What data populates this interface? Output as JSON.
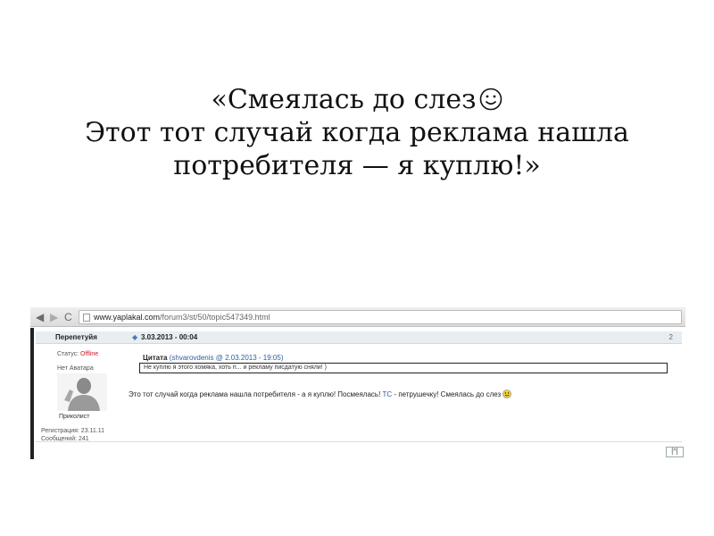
{
  "slide": {
    "quote_line1": "«Смеялась до слез",
    "quote_line2": "Этот тот случай когда реклама нашла",
    "quote_line3": "потребителя — я куплю!»",
    "smiley_icon": "smiley-face-icon"
  },
  "browser": {
    "back_glyph": "◀",
    "forward_glyph": "▶",
    "reload_glyph": "C",
    "url_domain": "www.yaplakal.com",
    "url_path": "/forum3/st/50/topic547349.html"
  },
  "post": {
    "author": "Перепетуйя",
    "date": "3.03.2013 - 00:04",
    "number": "2",
    "status_label": "Статус:",
    "status_value": "Offline",
    "no_avatar": "Нет Аватара",
    "rank": "Приколист",
    "registered": "Регистрация: 23.11.11",
    "messages": "Сообщений: 241",
    "quote_label": "Цитата",
    "quote_author": "(shvarovdenis @ 2.03.2013 - 19:05)",
    "quote_text": "Не куплю я этого хомяка, хоть п... и рекламу писдатую сняли! )",
    "body_part1": "Это тот случай когда реклама нашла потребителя - а я куплю! Посмеялась!",
    "body_tc": "ТС",
    "body_part2": "- петрушечку! Смеялась до слез",
    "top_link": "[^]"
  },
  "colors": {
    "offline": "#c8202a",
    "link": "#2d5d9e",
    "header_bg": "#e8edf2"
  }
}
